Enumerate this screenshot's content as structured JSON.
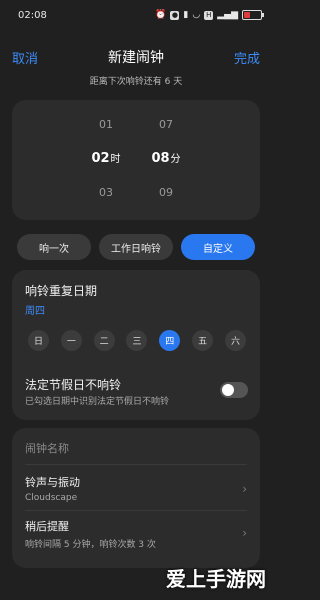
{
  "status": {
    "time": "02:08",
    "battery_color": "#e03b3b"
  },
  "header": {
    "cancel_label": "取消",
    "title": "新建闹钟",
    "done_label": "完成"
  },
  "countdown_text": "距离下次响铃还有 6 天",
  "picker": {
    "hour": {
      "prev": "01",
      "selected": "02",
      "unit": "时",
      "next": "03"
    },
    "minute": {
      "prev": "07",
      "selected": "08",
      "unit": "分",
      "next": "09"
    }
  },
  "modes": [
    {
      "label": "响一次",
      "active": false
    },
    {
      "label": "工作日响铃",
      "active": false
    },
    {
      "label": "自定义",
      "active": true
    }
  ],
  "repeat": {
    "title": "响铃重复日期",
    "summary": "周四",
    "days": [
      {
        "label": "日",
        "on": false
      },
      {
        "label": "一",
        "on": false
      },
      {
        "label": "二",
        "on": false
      },
      {
        "label": "三",
        "on": false
      },
      {
        "label": "四",
        "on": true
      },
      {
        "label": "五",
        "on": false
      },
      {
        "label": "六",
        "on": false
      }
    ]
  },
  "holiday": {
    "title": "法定节假日不响铃",
    "subtitle": "已勾选日期中识别法定节假日不响铃",
    "enabled": false
  },
  "settings": {
    "name_placeholder": "闹钟名称",
    "ringtone": {
      "title": "铃声与振动",
      "value": "Cloudscape"
    },
    "snooze": {
      "title": "稍后提醒",
      "value": "响铃间隔 5 分钟，响铃次数 3 次"
    }
  },
  "watermark": "爱上手游网",
  "colors": {
    "accent": "#2a78f0",
    "link": "#3d8bf7",
    "background": "#202020"
  }
}
